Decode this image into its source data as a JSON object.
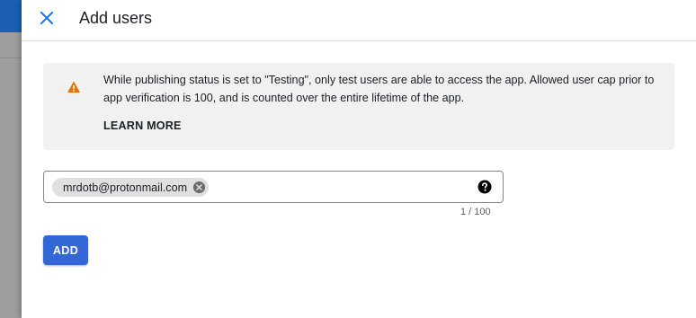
{
  "dialog": {
    "title": "Add users"
  },
  "notice": {
    "icon": "warning-icon",
    "icon_color": "#e37400",
    "text": "While publishing status is set to \"Testing\", only test users are able to access the app. Allowed user cap prior to app verification is 100, and is counted over the entire lifetime of the app.",
    "learn_more_label": "LEARN MORE"
  },
  "users_field": {
    "chips": [
      {
        "label": "mrdotb@protonmail.com"
      }
    ],
    "help_icon": "help-circle-icon",
    "counter": "1 / 100"
  },
  "actions": {
    "add_label": "ADD",
    "accent_color": "#3367d6"
  }
}
